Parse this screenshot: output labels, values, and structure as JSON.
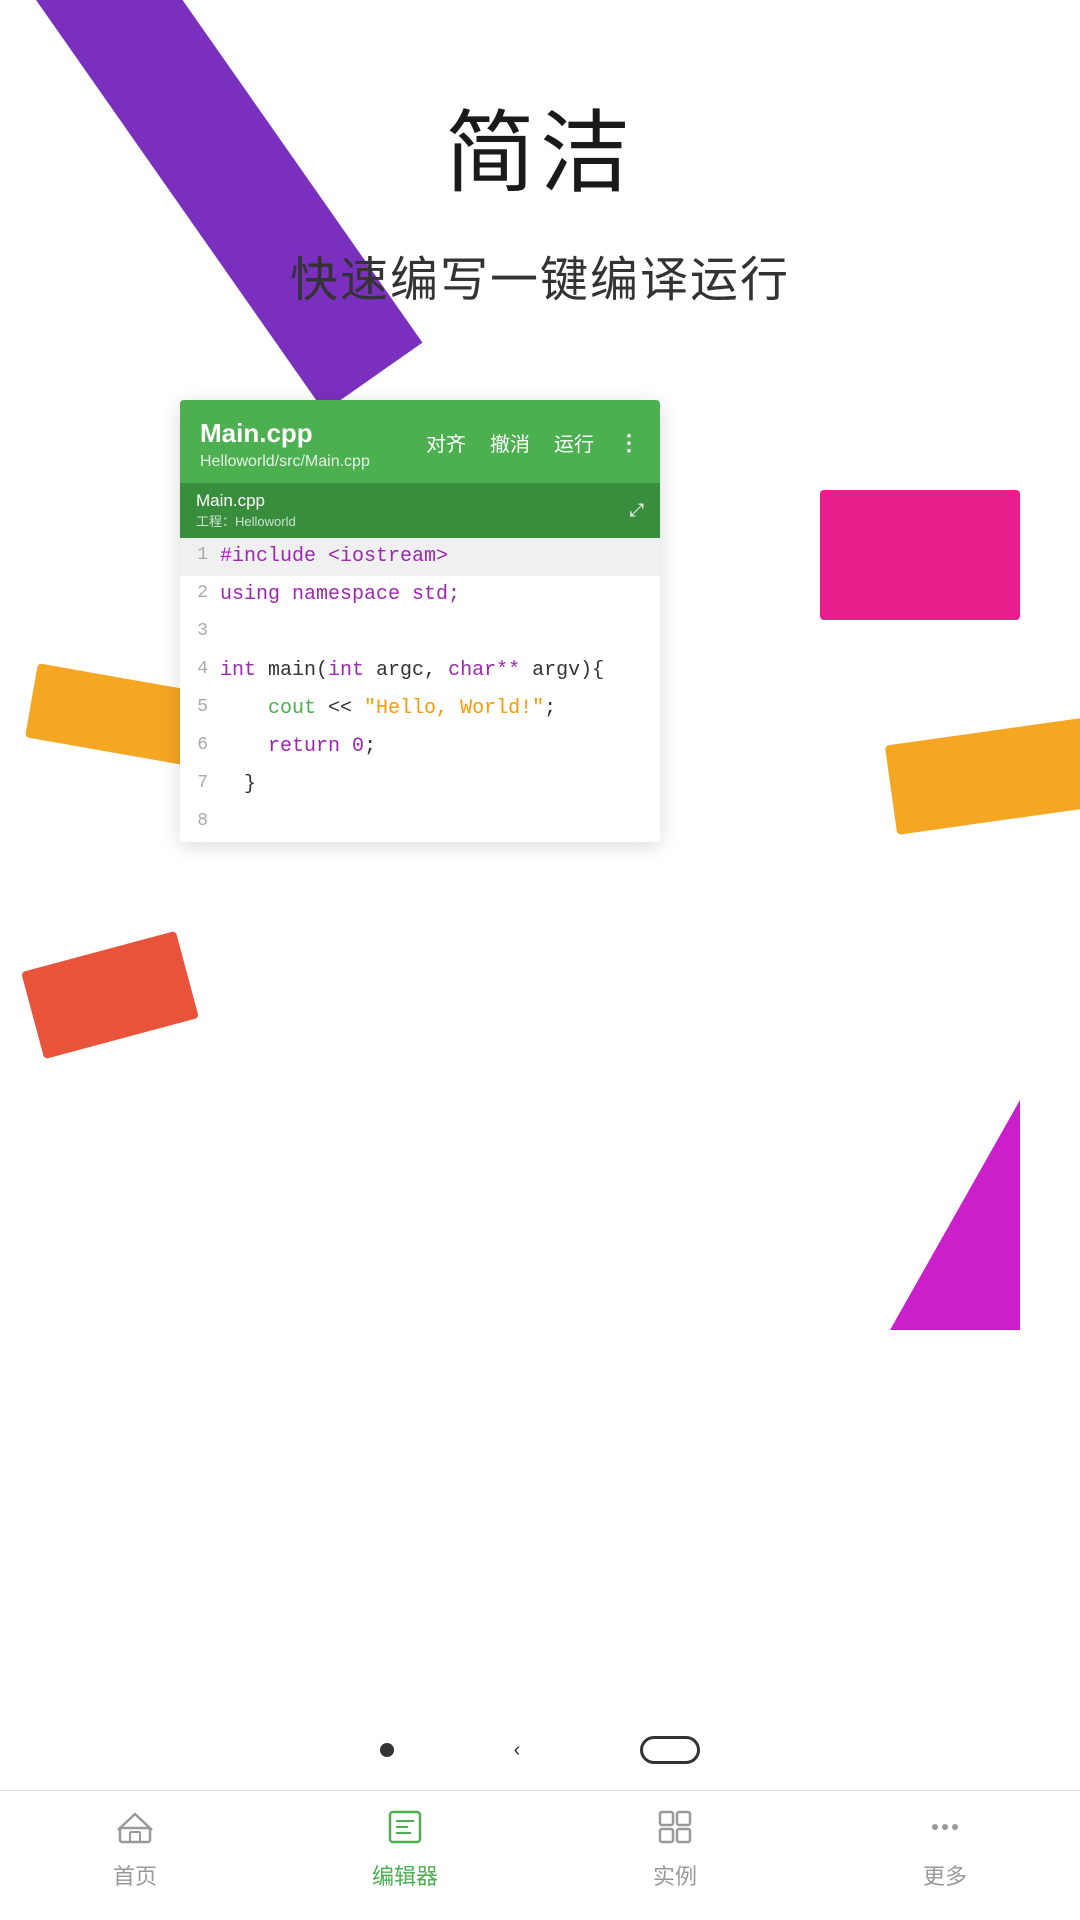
{
  "page": {
    "title": "简洁",
    "subtitle": "快速编写一键编译运行"
  },
  "editor": {
    "filename": "Main.cpp",
    "filepath": "Helloworld/src/Main.cpp",
    "tab_filename": "Main.cpp",
    "tab_project": "工程：Helloworld",
    "actions": {
      "align": "对齐",
      "undo": "撤消",
      "run": "运行",
      "more": "⋮"
    },
    "expand_icon": "⤢"
  },
  "code": {
    "lines": [
      {
        "num": "1",
        "content": "#include <iostream>",
        "type": "include"
      },
      {
        "num": "2",
        "content": "using namespace std;",
        "type": "using"
      },
      {
        "num": "3",
        "content": "",
        "type": "empty"
      },
      {
        "num": "4",
        "content": "int main(int argc, char** argv){",
        "type": "func"
      },
      {
        "num": "5",
        "content": "    cout << \"Hello, World!\";",
        "type": "cout"
      },
      {
        "num": "6",
        "content": "    return 0;",
        "type": "return"
      },
      {
        "num": "7",
        "content": "  }",
        "type": "brace"
      },
      {
        "num": "8",
        "content": "",
        "type": "empty"
      }
    ]
  },
  "nav": {
    "items": [
      {
        "id": "home",
        "label": "首页",
        "active": false
      },
      {
        "id": "editor",
        "label": "编辑器",
        "active": true
      },
      {
        "id": "examples",
        "label": "实例",
        "active": false
      },
      {
        "id": "more",
        "label": "更多",
        "active": false
      }
    ]
  }
}
